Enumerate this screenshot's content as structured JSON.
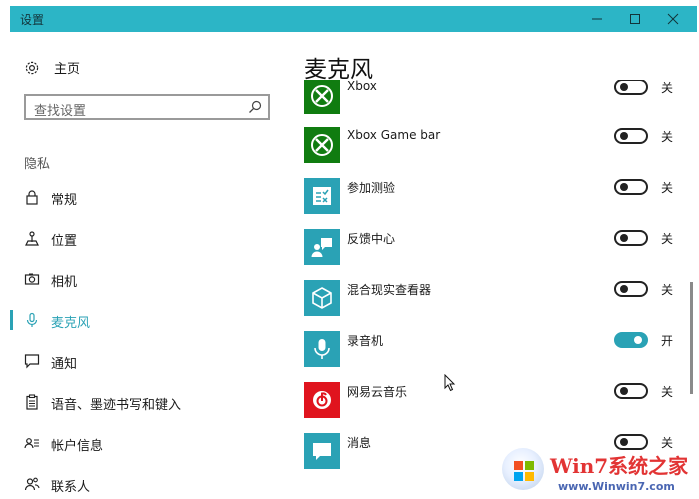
{
  "window": {
    "title": "设置"
  },
  "sidebar": {
    "home_label": "主页",
    "search_placeholder": "查找设置",
    "section_label": "隐私",
    "items": [
      {
        "label": "常规",
        "icon": "lock-icon"
      },
      {
        "label": "位置",
        "icon": "location-icon"
      },
      {
        "label": "相机",
        "icon": "camera-icon"
      },
      {
        "label": "麦克风",
        "icon": "microphone-icon",
        "selected": true
      },
      {
        "label": "通知",
        "icon": "notification-icon"
      },
      {
        "label": "语音、墨迹书写和键入",
        "icon": "clipboard-icon"
      },
      {
        "label": "帐户信息",
        "icon": "account-info-icon"
      },
      {
        "label": "联系人",
        "icon": "contacts-icon"
      }
    ]
  },
  "main": {
    "title": "麦克风",
    "apps": [
      {
        "name": "Xbox",
        "state": "关",
        "on": false,
        "icon": "xbox-icon",
        "color": "#107c10"
      },
      {
        "name": "Xbox Game bar",
        "state": "关",
        "on": false,
        "icon": "xbox-icon",
        "color": "#107c10"
      },
      {
        "name": "参加测验",
        "state": "关",
        "on": false,
        "icon": "checklist-icon",
        "color": "#2aa2b5"
      },
      {
        "name": "反馈中心",
        "state": "关",
        "on": false,
        "icon": "feedback-icon",
        "color": "#2aa2b5"
      },
      {
        "name": "混合现实查看器",
        "state": "关",
        "on": false,
        "icon": "cube-icon",
        "color": "#2aa2b5"
      },
      {
        "name": "录音机",
        "state": "开",
        "on": true,
        "icon": "microphone-icon",
        "color": "#2aa2b5"
      },
      {
        "name": "网易云音乐",
        "state": "关",
        "on": false,
        "icon": "netease-music-icon",
        "color": "#e0141e"
      },
      {
        "name": "消息",
        "state": "关",
        "on": false,
        "icon": "message-icon",
        "color": "#2aa2b5"
      }
    ]
  },
  "watermark": {
    "title": "Win7系统之家",
    "url": "www.Winwin7.com"
  },
  "colors": {
    "titlebar": "#2cb5c6",
    "accent": "#2aa2b5",
    "xbox": "#107c10",
    "netease": "#e0141e"
  }
}
